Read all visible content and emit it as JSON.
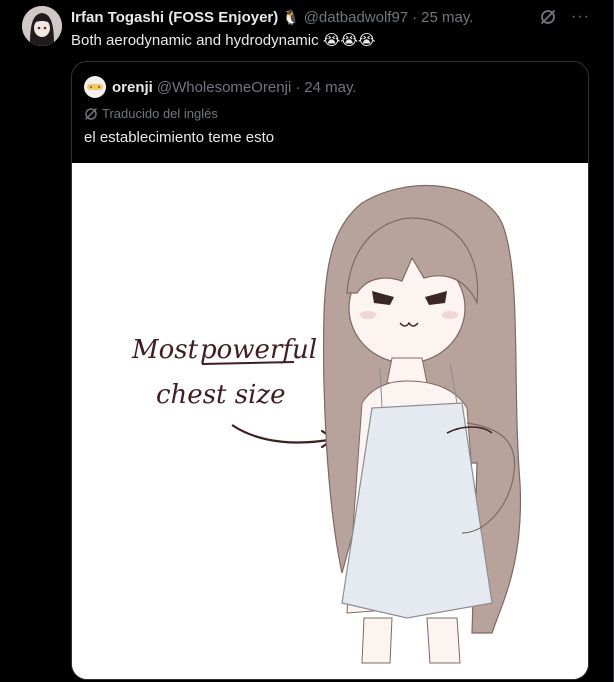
{
  "tweet": {
    "author_name": "Irfan Togashi (FOSS Enjoyer)",
    "author_emoji": "🐧",
    "handle": "@datbadwolf97",
    "separator": "·",
    "date": "25 may.",
    "text": "Both aerodynamic and hydrodynamic",
    "emojis": "😭😭😭",
    "more_icon": "···",
    "icons": {
      "grok": "grok-icon",
      "more": "more-icon",
      "avatar": "avatar"
    }
  },
  "quote": {
    "author_name": "orenji",
    "handle": "@WholesomeOrenji",
    "separator": "·",
    "date": "24 may.",
    "translation_label": "Traducido del inglés",
    "text": "el establecimiento teme esto",
    "image": {
      "caption_line1": "Most",
      "caption_line1b": "powerful",
      "caption_line2": "chest size"
    }
  },
  "colors": {
    "background": "#000000",
    "muted": "#71767b",
    "text": "#e7e9ea",
    "border": "#2f3336",
    "caption": "#3f1d21"
  }
}
